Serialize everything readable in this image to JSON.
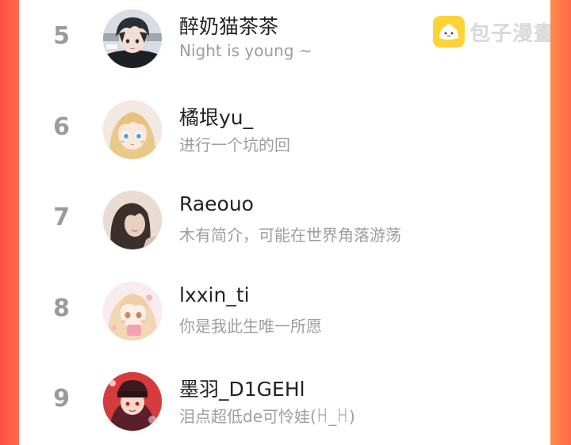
{
  "watermark": {
    "brand_text": "包子漫畫",
    "logo_icon": "baozi-bun-icon",
    "logo_color": "#ffd338"
  },
  "colors": {
    "rank_number": "#9b9b9b",
    "name": "#222222",
    "bio": "#9e9e9e",
    "side_gradient": "#ff5a42"
  },
  "ranking": [
    {
      "rank": "5",
      "name": "醉奶猫茶茶",
      "bio": "Night is young ~",
      "avatar": "avatar-dark-hair-boy"
    },
    {
      "rank": "6",
      "name": "橘垠yu_",
      "bio": "进行一个坑的回",
      "avatar": "avatar-blonde-anime-girl"
    },
    {
      "rank": "7",
      "name": "Raeouo",
      "bio": "木有简介，可能在世界角落游荡",
      "avatar": "avatar-photo-girl"
    },
    {
      "rank": "8",
      "name": "lxxin_ti",
      "bio": "你是我此生唯一所愿",
      "avatar": "avatar-pink-anime-girl"
    },
    {
      "rank": "9",
      "name": "墨羽_D1GEHl",
      "bio": "泪点超低de可怜娃(ꀿ_ꀿ)",
      "avatar": "avatar-red-anime-character"
    }
  ]
}
